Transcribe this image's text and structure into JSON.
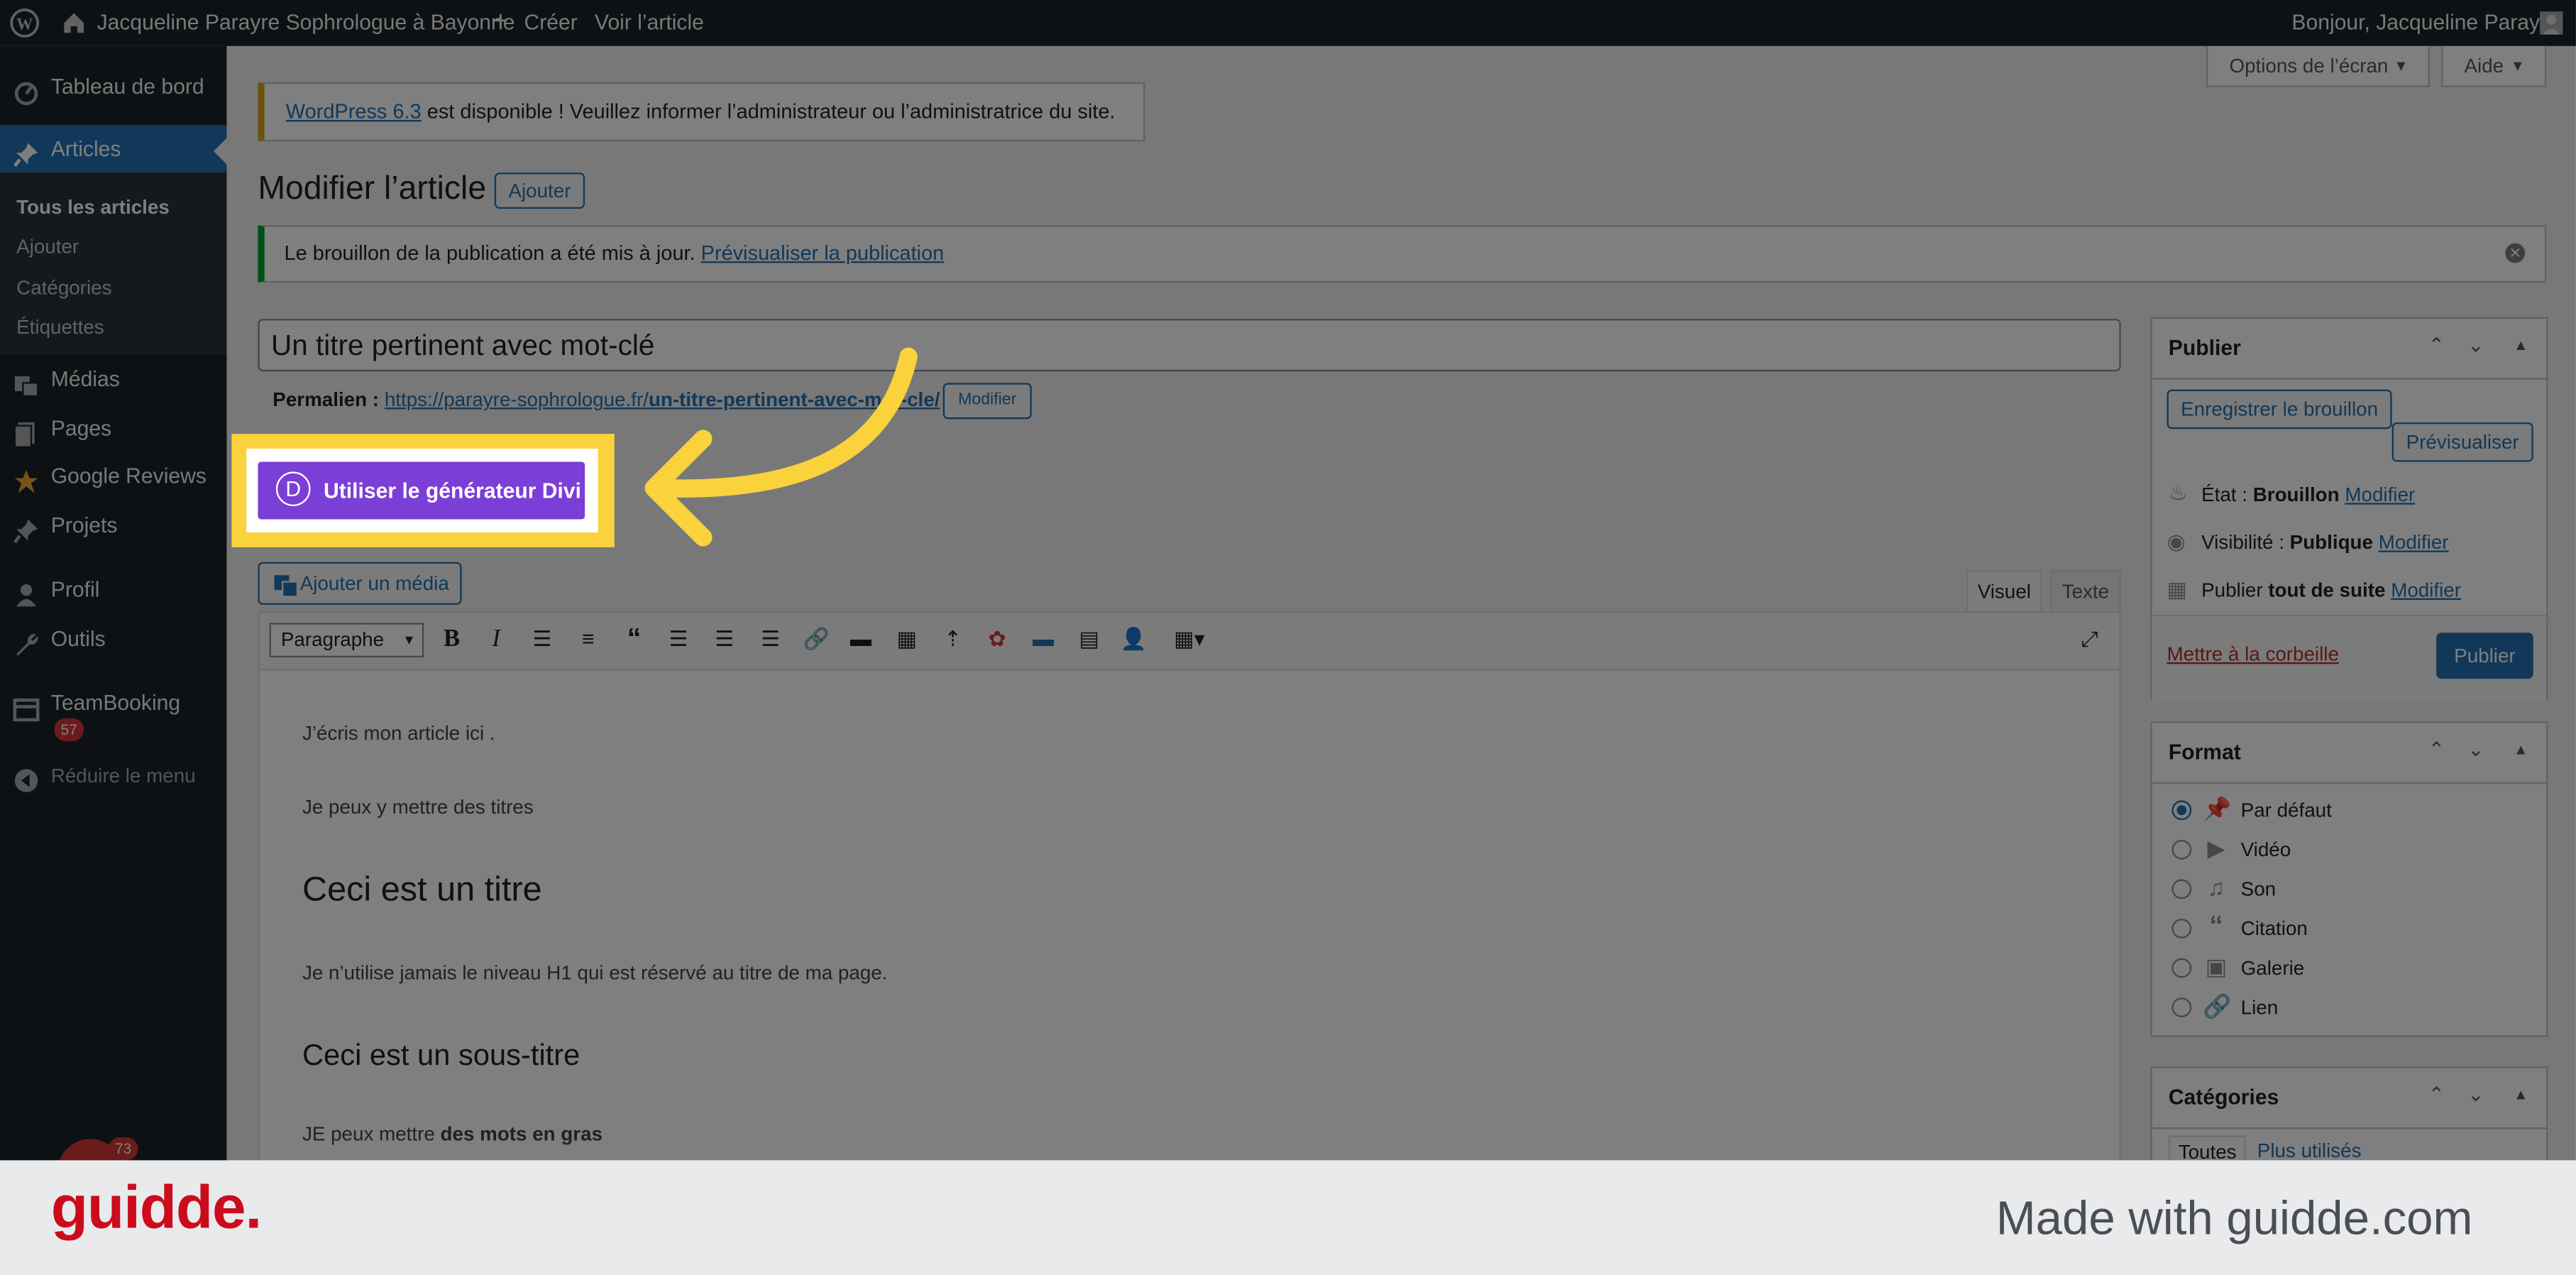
{
  "admin_bar": {
    "site_name": "Jacqueline Parayre Sophrologue à Bayonne",
    "create": "Créer",
    "view_post": "Voir l’article",
    "greeting": "Bonjour, Jacqueline Parayre"
  },
  "sidebar": {
    "dashboard": "Tableau de bord",
    "articles": "Articles",
    "submenu": [
      "Tous les articles",
      "Ajouter",
      "Catégories",
      "Étiquettes"
    ],
    "media": "Médias",
    "pages": "Pages",
    "google_reviews": "Google Reviews",
    "projects": "Projets",
    "profile": "Profil",
    "tools": "Outils",
    "teambooking": "TeamBooking",
    "teambooking_badge": "57",
    "collapse": "Réduire le menu",
    "chat_badge": "73"
  },
  "screen_options": {
    "options": "Options de l’écran",
    "help": "Aide"
  },
  "update_notice": {
    "link": "WordPress 6.3",
    "text": " est disponible ! Veuillez informer l’administrateur ou l’administratrice du site."
  },
  "page": {
    "title": "Modifier l’article",
    "add_button": "Ajouter"
  },
  "draft_notice": {
    "text": "Le brouillon de la publication a été mis à jour. ",
    "link": "Prévisualiser la publication"
  },
  "post": {
    "title": "Un titre pertinent avec mot-clé",
    "permalink_label": "Permalien :",
    "permalink_base": "https://parayre-sophrologue.fr/",
    "permalink_slug": "un-titre-pertinent-avec-mot-cle/",
    "permalink_edit": "Modifier"
  },
  "divi": {
    "letter": "D",
    "label": "Utiliser le générateur Divi"
  },
  "editor": {
    "add_media": "Ajouter un média",
    "tab_visual": "Visuel",
    "tab_text": "Texte",
    "format_select": "Paragraphe",
    "content": {
      "p1": "J’écris mon article ici .",
      "p2": "Je peux y mettre des titres",
      "h2": "Ceci est un titre",
      "p3": "Je n’utilise jamais le niveau H1 qui est réservé au titre de ma page.",
      "h3": "Ceci est un sous-titre",
      "p4_start": "JE peux mettre ",
      "p4_bold": "des mots en gras"
    }
  },
  "publish": {
    "title": "Publier",
    "save_draft": "Enregistrer le brouillon",
    "preview": "Prévisualiser",
    "status_label": "État : ",
    "status_value": "Brouillon",
    "visibility_label": "Visibilité : ",
    "visibility_value": "Publique",
    "publish_label": "Publier ",
    "publish_value": "tout de suite",
    "edit": "Modifier",
    "trash": "Mettre à la corbeille",
    "publish_button": "Publier"
  },
  "format_box": {
    "title": "Format",
    "options": [
      "Par défaut",
      "Vidéo",
      "Son",
      "Citation",
      "Galerie",
      "Lien"
    ],
    "selected": "Par défaut"
  },
  "categories_box": {
    "title": "Catégories",
    "tab_all": "Toutes",
    "tab_used": "Plus utilisés"
  },
  "footer": {
    "logo": "guidde.",
    "tagline": "Made with guidde.com"
  },
  "colors": {
    "admin_dark": "#1d2327",
    "wp_blue": "#2271b1",
    "divi_purple": "#7b3ed6",
    "highlight_yellow": "#f9d23c",
    "guidde_red": "#cb0c1c"
  }
}
